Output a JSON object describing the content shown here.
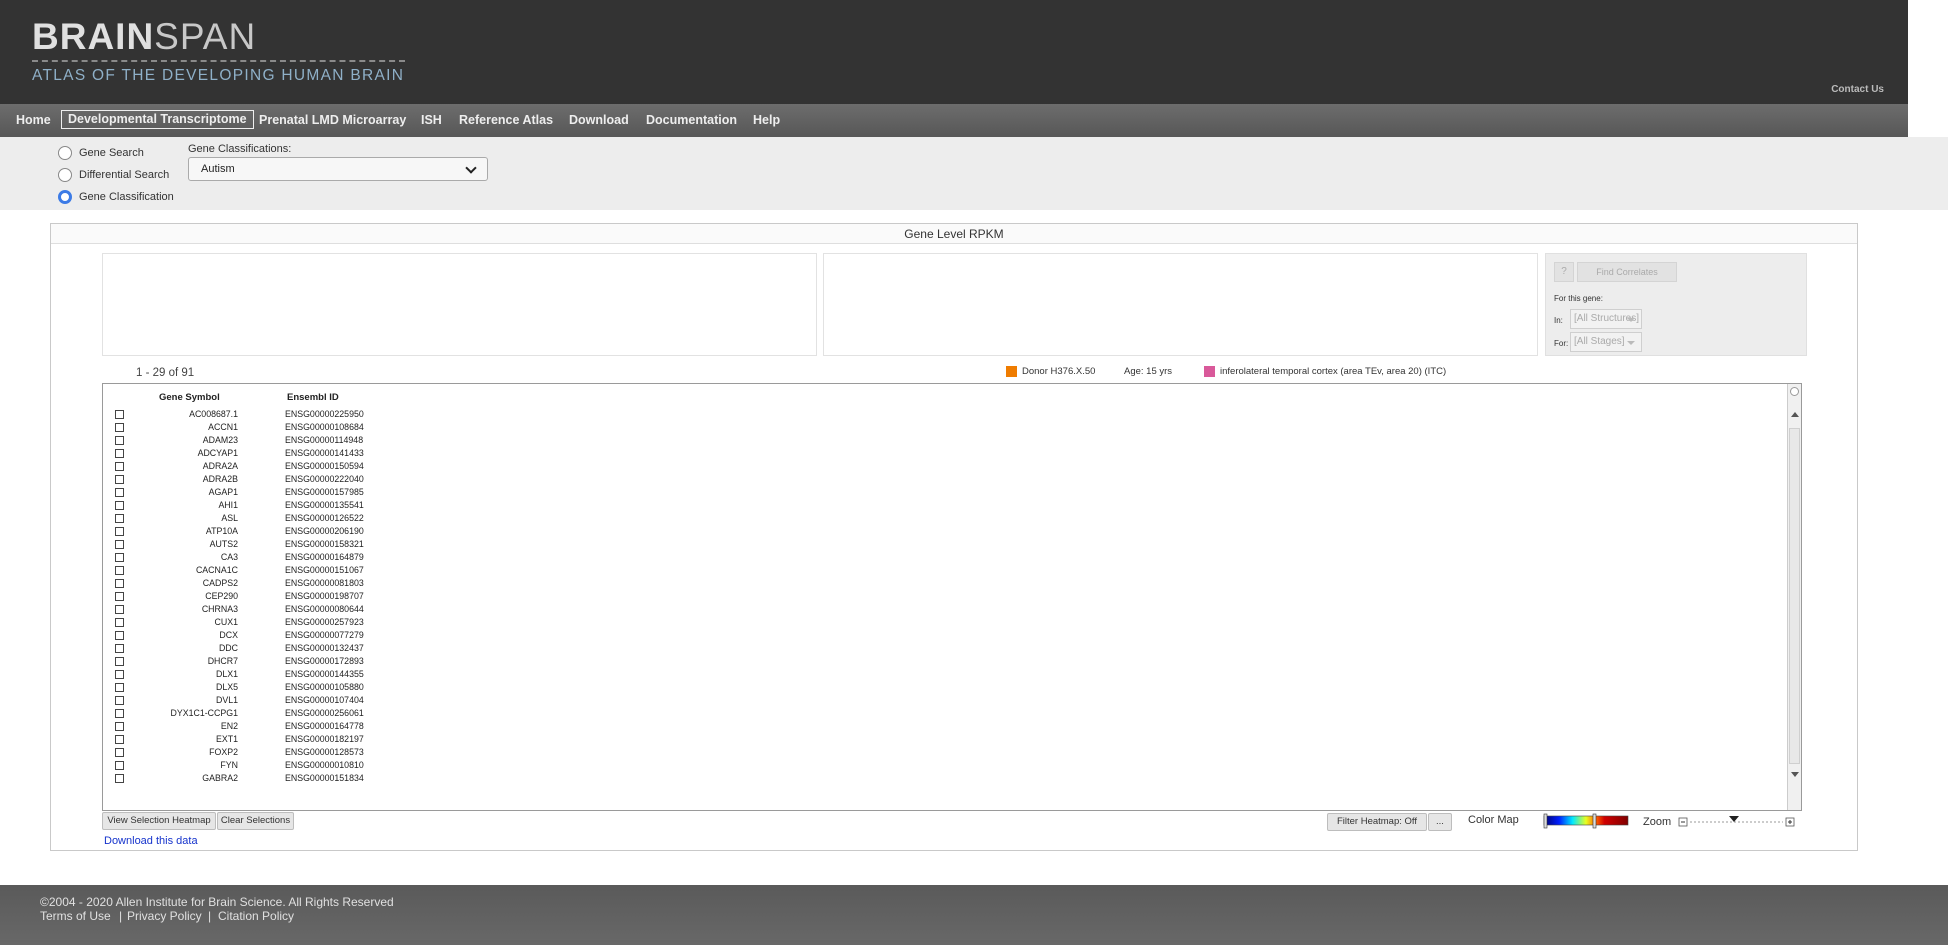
{
  "header": {
    "logo_bold": "BRAIN",
    "logo_light": "SPAN",
    "logo_subtitle": "ATLAS OF THE DEVELOPING HUMAN BRAIN",
    "contact": "Contact Us"
  },
  "nav": {
    "items": [
      {
        "label": "Home"
      },
      {
        "label": "Developmental Transcriptome",
        "active": true
      },
      {
        "label": "Prenatal LMD Microarray"
      },
      {
        "label": "ISH"
      },
      {
        "label": "Reference Atlas"
      },
      {
        "label": "Download"
      },
      {
        "label": "Documentation"
      },
      {
        "label": "Help"
      }
    ]
  },
  "search": {
    "options": [
      {
        "label": "Gene Search",
        "checked": false
      },
      {
        "label": "Differential Search",
        "checked": false
      },
      {
        "label": "Gene Classification",
        "checked": true
      }
    ],
    "classification_label": "Gene Classifications:",
    "classification_value": "Autism"
  },
  "panel": {
    "title": "Gene Level RPKM",
    "correlates": {
      "help_label": "?",
      "find_label": "Find Correlates",
      "for_gene": "For this gene:",
      "in_label": "In:",
      "in_value": "[All Structures]",
      "for_label": "For:",
      "for_value": "[All Stages]"
    },
    "count": "1 - 29 of 91",
    "donor": "Donor H376.X.50",
    "age": "Age: 15 yrs",
    "structure": "inferolateral temporal cortex (area TEv, area 20) (ITC)",
    "donor_color": "#ef7c00",
    "structure_color": "#d9599a"
  },
  "table": {
    "col_symbol": "Gene Symbol",
    "col_ensembl": "Ensembl ID",
    "rows": [
      {
        "symbol": "AC008687.1",
        "ensembl": "ENSG00000225950"
      },
      {
        "symbol": "ACCN1",
        "ensembl": "ENSG00000108684"
      },
      {
        "symbol": "ADAM23",
        "ensembl": "ENSG00000114948"
      },
      {
        "symbol": "ADCYAP1",
        "ensembl": "ENSG00000141433"
      },
      {
        "symbol": "ADRA2A",
        "ensembl": "ENSG00000150594"
      },
      {
        "symbol": "ADRA2B",
        "ensembl": "ENSG00000222040"
      },
      {
        "symbol": "AGAP1",
        "ensembl": "ENSG00000157985"
      },
      {
        "symbol": "AHI1",
        "ensembl": "ENSG00000135541"
      },
      {
        "symbol": "ASL",
        "ensembl": "ENSG00000126522"
      },
      {
        "symbol": "ATP10A",
        "ensembl": "ENSG00000206190"
      },
      {
        "symbol": "AUTS2",
        "ensembl": "ENSG00000158321"
      },
      {
        "symbol": "CA3",
        "ensembl": "ENSG00000164879"
      },
      {
        "symbol": "CACNA1C",
        "ensembl": "ENSG00000151067"
      },
      {
        "symbol": "CADPS2",
        "ensembl": "ENSG00000081803"
      },
      {
        "symbol": "CEP290",
        "ensembl": "ENSG00000198707"
      },
      {
        "symbol": "CHRNA3",
        "ensembl": "ENSG00000080644"
      },
      {
        "symbol": "CUX1",
        "ensembl": "ENSG00000257923"
      },
      {
        "symbol": "DCX",
        "ensembl": "ENSG00000077279"
      },
      {
        "symbol": "DDC",
        "ensembl": "ENSG00000132437"
      },
      {
        "symbol": "DHCR7",
        "ensembl": "ENSG00000172893"
      },
      {
        "symbol": "DLX1",
        "ensembl": "ENSG00000144355"
      },
      {
        "symbol": "DLX5",
        "ensembl": "ENSG00000105880"
      },
      {
        "symbol": "DVL1",
        "ensembl": "ENSG00000107404"
      },
      {
        "symbol": "DYX1C1-CCPG1",
        "ensembl": "ENSG00000256061"
      },
      {
        "symbol": "EN2",
        "ensembl": "ENSG00000164778"
      },
      {
        "symbol": "EXT1",
        "ensembl": "ENSG00000182197"
      },
      {
        "symbol": "FOXP2",
        "ensembl": "ENSG00000128573"
      },
      {
        "symbol": "FYN",
        "ensembl": "ENSG00000010810"
      },
      {
        "symbol": "GABRA2",
        "ensembl": "ENSG00000151834"
      }
    ]
  },
  "controls": {
    "view_selection": "View Selection Heatmap",
    "clear_selections": "Clear Selections",
    "download": "Download this data",
    "filter": "Filter Heatmap: Off",
    "more": "...",
    "color_map": "Color Map",
    "zoom": "Zoom"
  },
  "footer": {
    "copyright": "©2004 - 2020 Allen Institute for Brain Science. All Rights Reserved",
    "links": [
      "Terms of Use",
      "Privacy Policy",
      "Citation Policy"
    ],
    "separator": "|"
  }
}
